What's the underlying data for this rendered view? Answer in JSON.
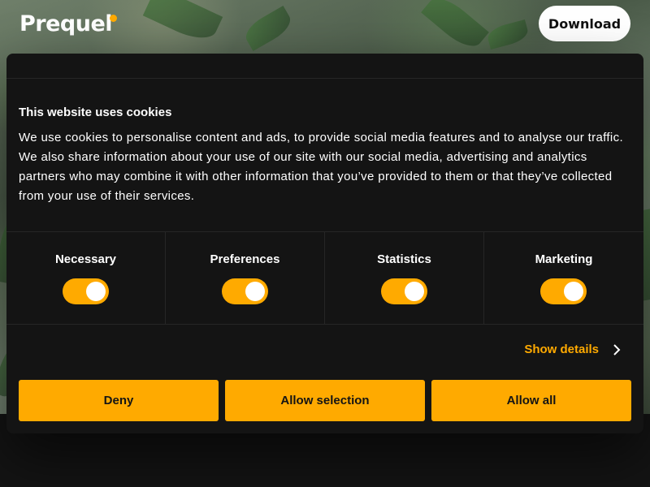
{
  "header": {
    "logo_text": "Prequel",
    "download_label": "Download"
  },
  "cookie_dialog": {
    "title": "This website uses cookies",
    "body": "We use cookies to personalise content and ads, to provide social media features and to analyse our traffic. We also share information about your use of our site with our social media, advertising and analytics partners who may combine it with other information that you’ve provided to them or that they’ve collected from your use of their services.",
    "categories": [
      {
        "label": "Necessary",
        "enabled": true
      },
      {
        "label": "Preferences",
        "enabled": true
      },
      {
        "label": "Statistics",
        "enabled": true
      },
      {
        "label": "Marketing",
        "enabled": true
      }
    ],
    "show_details_label": "Show details",
    "buttons": {
      "deny": "Deny",
      "allow_selection": "Allow selection",
      "allow_all": "Allow all"
    }
  },
  "colors": {
    "accent": "#ffaa00",
    "dialog_bg": "#141414",
    "text": "#ffffff"
  },
  "icons": {
    "logo_dot": "dot",
    "show_details": "chevron-right-icon"
  }
}
